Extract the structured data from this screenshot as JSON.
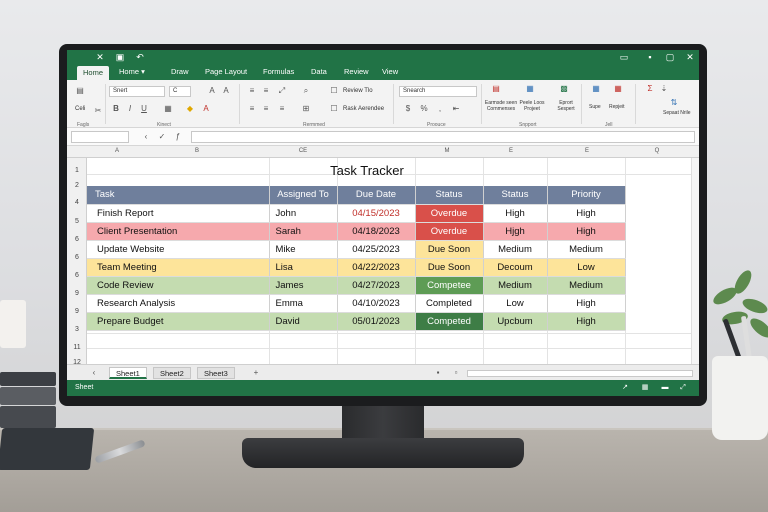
{
  "ribbon": {
    "tabs": [
      "Home",
      "Home ▾",
      "Draw",
      "Page Layout",
      "Formulas",
      "Data",
      "Review",
      "View"
    ],
    "font_name": "Snert",
    "font_size": "C",
    "review_label": "Review Tlo",
    "rask_label": "Rask Aerendee",
    "search_placeholder": "Snearch",
    "clipboard_label": "Fagls",
    "font_group_label": "Kinect",
    "align_group_label": "Rermmed",
    "number_group_label": "Proouce",
    "styles_group_label": "Snpport",
    "cells_group_label": "Jell",
    "btn_conditional": "Earmsde seen Cornmenses",
    "btn_format_table": "Peele Loos Projeet",
    "btn_cell_styles": "Eprort Sespert",
    "btn_insert": "Supe",
    "btn_delete": "Repjeit",
    "btn_sort": "Sepaat Nrile",
    "misc_a": "Celi"
  },
  "columns": [
    "A",
    "B",
    "CE",
    "M",
    "E",
    "E",
    "Q"
  ],
  "row_numbers": [
    "1",
    "2",
    "4",
    "5",
    "6",
    "6",
    "6",
    "9",
    "9",
    "3",
    "11",
    "12"
  ],
  "sheet": {
    "title": "Task Tracker",
    "headers": [
      "Task",
      "Assigned To",
      "Due Date",
      "Status",
      "Status",
      "Priority"
    ],
    "rows": [
      {
        "task": "Finish Report",
        "assigned": "John",
        "due": "04/15/2023",
        "status": "Overdue",
        "status2": "High",
        "priority": "High"
      },
      {
        "task": "Client Presentation",
        "assigned": "Sarah",
        "due": "04/18/2023",
        "status": "Overdue",
        "status2": "Hjgh",
        "priority": "High"
      },
      {
        "task": "Update Website",
        "assigned": "Mike",
        "due": "04/25/2023",
        "status": "Due Soon",
        "status2": "Medium",
        "priority": "Medium"
      },
      {
        "task": "Team Meeting",
        "assigned": "Lisa",
        "due": "04/22/2023",
        "status": "Due Soon",
        "status2": "Decoum",
        "priority": "Low"
      },
      {
        "task": "Code Review",
        "assigned": "James",
        "due": "04/27/2023",
        "status": "Competee",
        "status2": "Medium",
        "priority": "Medium"
      },
      {
        "task": "Research Analysis",
        "assigned": "Emma",
        "due": "04/10/2023",
        "status": "Completed",
        "status2": "Low",
        "priority": "High"
      },
      {
        "task": "Prepare Budget",
        "assigned": "David",
        "due": "05/01/2023",
        "status": "Competed",
        "status2": "Upcbum",
        "priority": "High"
      }
    ]
  },
  "sheet_tabs": [
    "Sheet1",
    "Sheet2",
    "Sheet3"
  ],
  "status_bar": {
    "label": "Sheet"
  },
  "colors": {
    "excel_green": "#217346",
    "header_fill": "#6f7f9c",
    "overdue_red": "#d9504a",
    "overdue_row": "#f6a9ad",
    "due_soon_row": "#fde49a",
    "complete_row": "#c4dcb0",
    "complete_green": "#5e9c55",
    "complete_dark": "#3e7d46",
    "date_red": "#c0302a"
  }
}
